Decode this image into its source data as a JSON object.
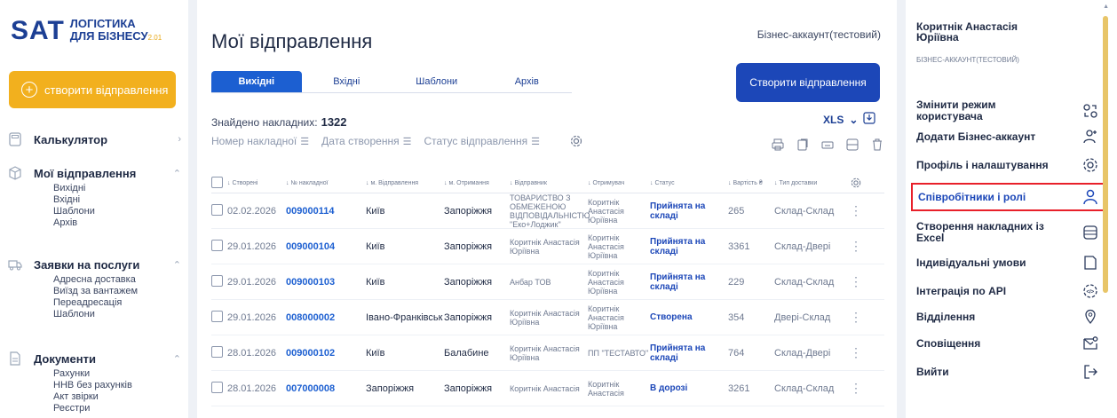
{
  "logo": {
    "brand": "SAT",
    "line1": "ЛОГІСТИКА",
    "line2": "ДЛЯ БІЗНЕСУ",
    "version": "2.01"
  },
  "sidebar": {
    "create_label": "створити відправлення",
    "sections": [
      {
        "label": "Калькулятор",
        "icon": "calculator-icon",
        "items": []
      },
      {
        "label": "Мої відправлення",
        "icon": "package-icon",
        "items": [
          "Вихідні",
          "Вхідні",
          "Шаблони",
          "Архів"
        ]
      },
      {
        "label": "Заявки на послуги",
        "icon": "truck-icon",
        "items": [
          "Адресна доставка",
          "Виїзд за вантажем",
          "Переадресація",
          "Шаблони"
        ]
      },
      {
        "label": "Документи",
        "icon": "document-icon",
        "items": [
          "Рахунки",
          "ННВ без рахунків",
          "Акт звірки",
          "Реєстри"
        ]
      }
    ]
  },
  "main": {
    "title": "Мої відправлення",
    "account": "Бізнес-аккаунт(тестовий)",
    "tabs": [
      "Вихідні",
      "Вхідні",
      "Шаблони",
      "Архів"
    ],
    "create_button": "Створити відправлення",
    "found_label": "Знайдено накладних:",
    "found_count": "1322",
    "export_label": "XLS",
    "filters": [
      "Номер накладної",
      "Дата створення",
      "Статус відправлення"
    ],
    "columns": [
      "Створені",
      "№ накладної",
      "м. Відправлення",
      "м. Отримання",
      "Відправник",
      "Отримувач",
      "Статус",
      "Вартість ₴",
      "Тип доставки"
    ],
    "rows": [
      {
        "date": "02.02.2026",
        "number": "009000114",
        "from": "Київ",
        "to": "Запоріжжя",
        "sender": "ТОВАРИСТВО З ОБМЕЖЕНОЮ ВІДПОВІДАЛЬНІСТЮ \"Еко+Лоджик\"",
        "receiver": "Коритнік Анастасія Юріївна",
        "status": "Прийнята на складі",
        "cost": "265",
        "type": "Склад-Склад"
      },
      {
        "date": "29.01.2026",
        "number": "009000104",
        "from": "Київ",
        "to": "Запоріжжя",
        "sender": "Коритнік Анастасія Юріївна",
        "receiver": "Коритнік Анастасія Юріївна",
        "status": "Прийнята на складі",
        "cost": "3361",
        "type": "Склад-Двері"
      },
      {
        "date": "29.01.2026",
        "number": "009000103",
        "from": "Київ",
        "to": "Запоріжжя",
        "sender": "Анбар ТОВ",
        "receiver": "Коритнік Анастасія Юріївна",
        "status": "Прийнята на складі",
        "cost": "229",
        "type": "Склад-Склад"
      },
      {
        "date": "29.01.2026",
        "number": "008000002",
        "from": "Івано-Франківськ",
        "to": "Запоріжжя",
        "sender": "Коритнік Анастасія Юріївна",
        "receiver": "Коритнік Анастасія Юріївна",
        "status": "Створена",
        "cost": "354",
        "type": "Двері-Склад"
      },
      {
        "date": "28.01.2026",
        "number": "009000102",
        "from": "Київ",
        "to": "Балабине",
        "sender": "Коритнік Анастасія Юріївна",
        "receiver": "ПП \"ТЕСТАВТО\"",
        "status": "Прийнята на складі",
        "cost": "764",
        "type": "Склад-Двері"
      },
      {
        "date": "28.01.2026",
        "number": "007000008",
        "from": "Запоріжжя",
        "to": "Запоріжжя",
        "sender": "Коритнік Анастасія",
        "receiver": "Коритнік Анастасія",
        "status": "В дорозі",
        "cost": "3261",
        "type": "Склад-Склад"
      }
    ]
  },
  "user": {
    "name": "Коритнік Анастасія Юріївна",
    "role": "БІЗНЕС-АККАУНТ(ТЕСТОВИЙ)"
  },
  "menu": [
    {
      "label": "Змінити режим користувача",
      "icon": "switch-mode-icon"
    },
    {
      "label": "Додати Бізнес-аккаунт",
      "icon": "add-user-icon"
    },
    {
      "label": "Профіль і налаштування",
      "icon": "gear-icon"
    },
    {
      "label": "Співробітники і ролі",
      "icon": "user-icon"
    },
    {
      "label": "Створення накладних із Excel",
      "icon": "table-icon"
    },
    {
      "label": "Індивідуальні умови",
      "icon": "file-icon"
    },
    {
      "label": "Інтеграція по API",
      "icon": "api-gear-icon"
    },
    {
      "label": "Відділення",
      "icon": "location-icon"
    },
    {
      "label": "Сповіщення",
      "icon": "notification-icon"
    },
    {
      "label": "Вийти",
      "icon": "logout-icon"
    }
  ],
  "colors": {
    "accent": "#1c47b8",
    "brand_yellow": "#f2b01e",
    "highlight": "#e8202a"
  }
}
